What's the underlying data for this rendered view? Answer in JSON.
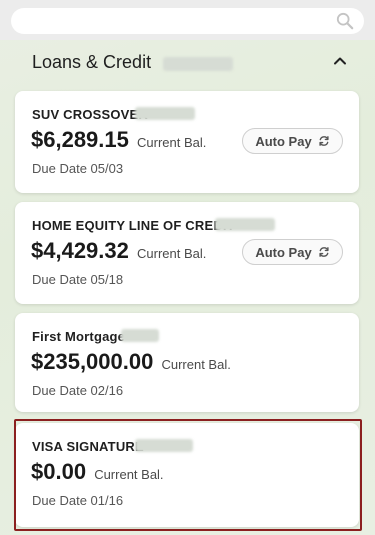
{
  "search": {
    "placeholder": ""
  },
  "section": {
    "title": "Loans & Credit"
  },
  "cards": [
    {
      "name": "SUV CROSSOVER",
      "amount": "$6,289.15",
      "balance_label": "Current Bal.",
      "due": "Due Date 05/03",
      "autopay_label": "Auto Pay"
    },
    {
      "name": "HOME EQUITY LINE OF CREDIT",
      "amount": "$4,429.32",
      "balance_label": "Current Bal.",
      "due": "Due Date 05/18",
      "autopay_label": "Auto Pay"
    },
    {
      "name": "First Mortgage",
      "amount": "$235,000.00",
      "balance_label": "Current Bal.",
      "due": "Due Date 02/16"
    },
    {
      "name": "VISA SIGNATURE",
      "amount": "$0.00",
      "balance_label": "Current Bal.",
      "due": "Due Date 01/16"
    }
  ],
  "colors": {
    "highlight": "#8b1f1f",
    "background": "#e6eedf"
  }
}
